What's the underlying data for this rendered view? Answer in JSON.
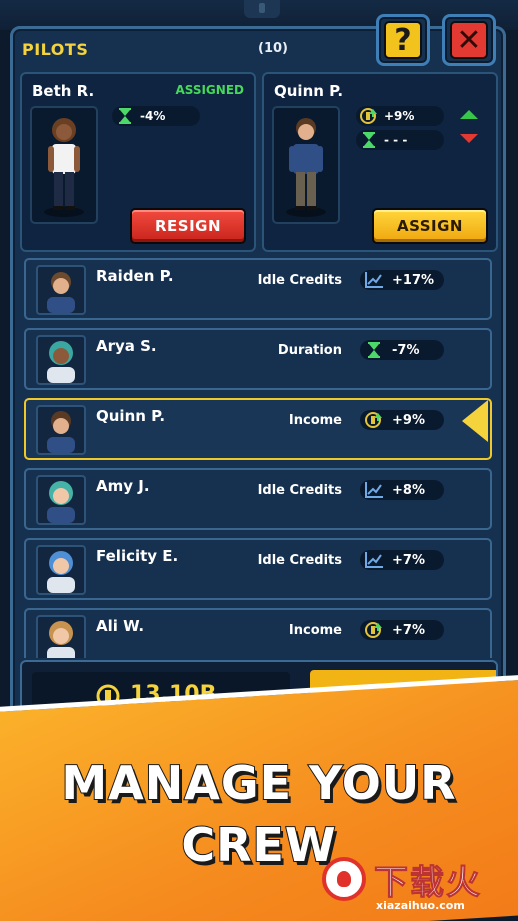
{
  "panel": {
    "title": "PILOTS",
    "count": "(10)"
  },
  "top_buttons": {
    "help": "?",
    "close": "✕"
  },
  "assigned_card": {
    "name": "Beth R.",
    "status": "ASSIGNED",
    "stat_icon": "hourglass-icon",
    "stat_value": "-4%",
    "button": "RESIGN"
  },
  "candidate_card": {
    "name": "Quinn P.",
    "stat1_icon": "income-coin-icon",
    "stat1_value": "+9%",
    "stat2_icon": "hourglass-icon",
    "stat2_value": "- - -",
    "button": "ASSIGN"
  },
  "pilots": [
    {
      "name": "Raiden P.",
      "type": "Idle Credits",
      "icon": "chart-up-icon",
      "value": "+17%",
      "selected": false
    },
    {
      "name": "Arya S.",
      "type": "Duration",
      "icon": "hourglass-icon",
      "value": "-7%",
      "selected": false
    },
    {
      "name": "Quinn P.",
      "type": "Income",
      "icon": "income-coin-icon",
      "value": "+9%",
      "selected": true
    },
    {
      "name": "Amy J.",
      "type": "Idle Credits",
      "icon": "chart-up-icon",
      "value": "+8%",
      "selected": false
    },
    {
      "name": "Felicity E.",
      "type": "Idle Credits",
      "icon": "chart-up-icon",
      "value": "+7%",
      "selected": false
    },
    {
      "name": "Ali W.",
      "type": "Income",
      "icon": "income-coin-icon",
      "value": "+7%",
      "selected": false
    }
  ],
  "currency": {
    "value": "13,10B"
  },
  "banner": {
    "line1": "MANAGE YOUR",
    "line2": "CREW"
  },
  "watermark": {
    "brand": "下载火",
    "url": "xiazaihuo.com"
  },
  "colors": {
    "accent_yellow": "#f5d33c",
    "assigned_green": "#47d85a",
    "resign_red": "#e23a32",
    "assign_yellow": "#f2b414",
    "panel_blue": "#16304f"
  }
}
